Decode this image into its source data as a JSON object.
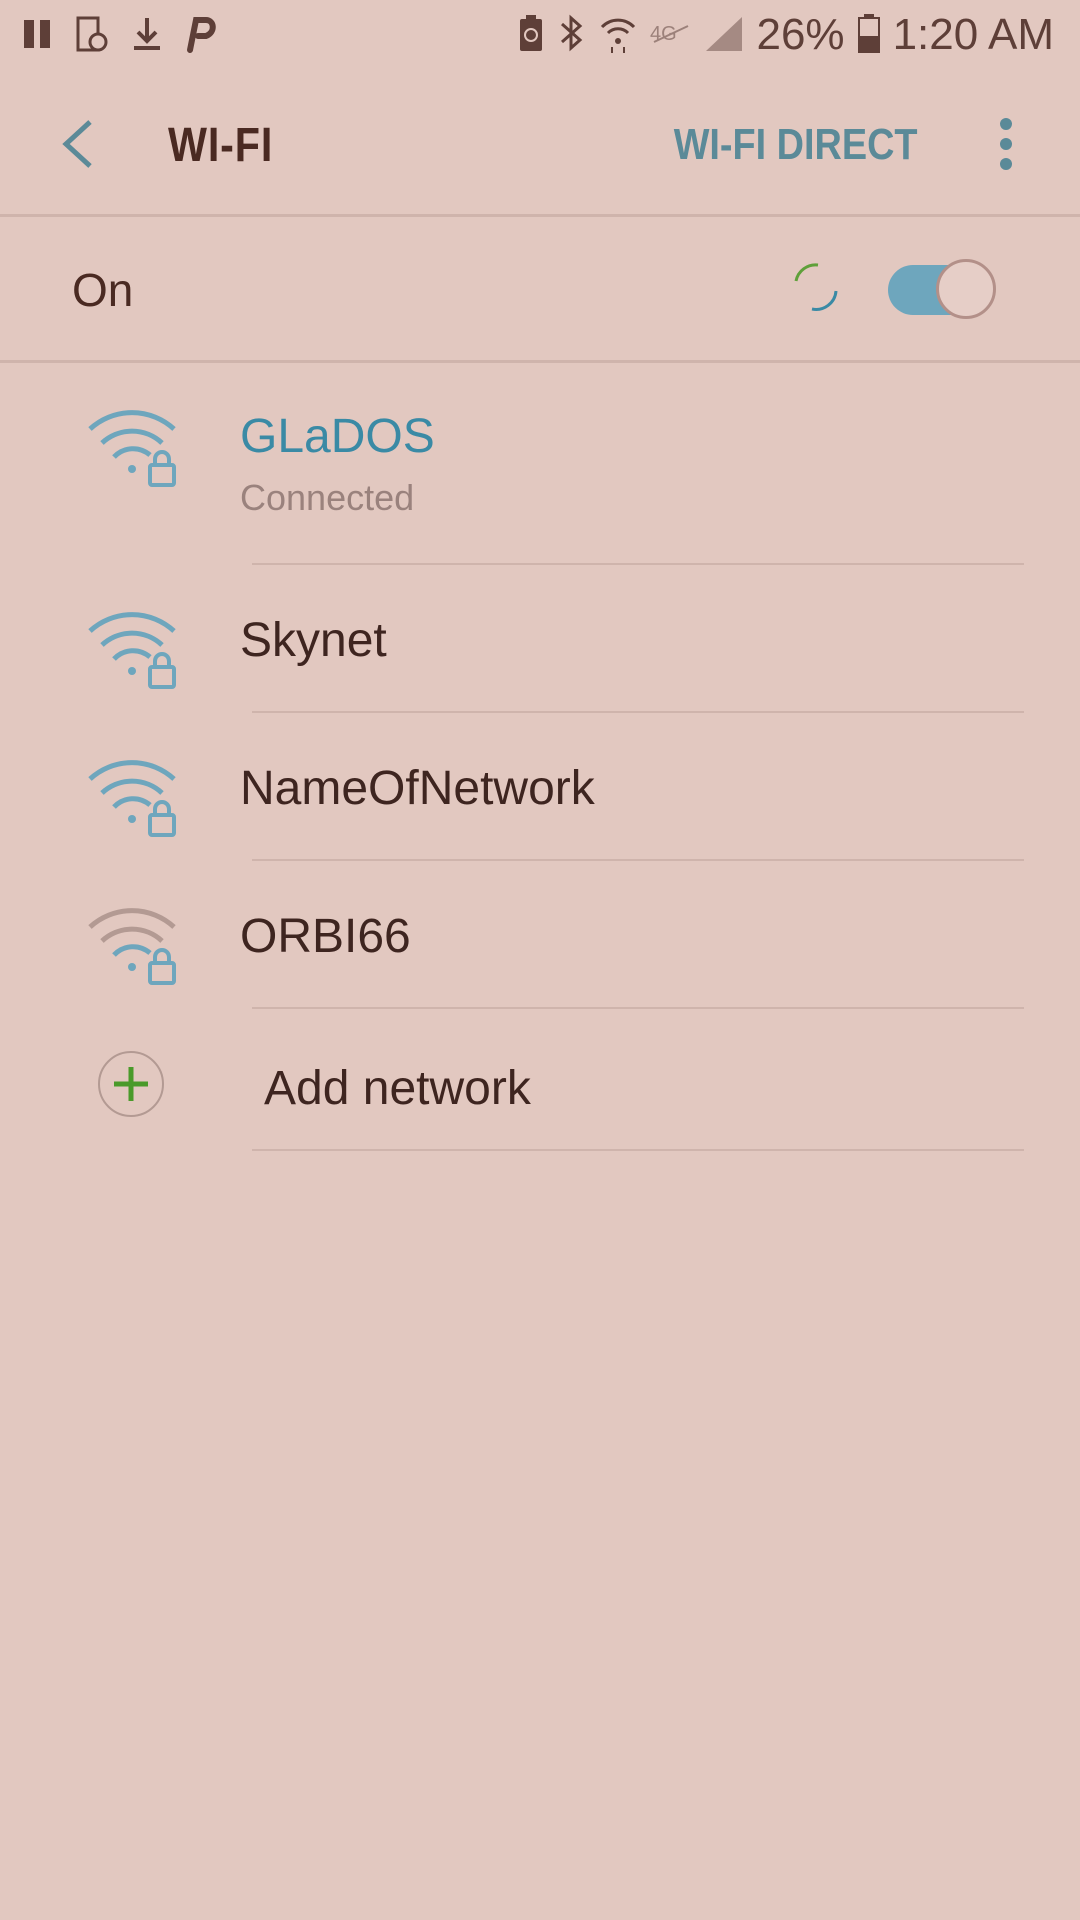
{
  "status_bar": {
    "left_icons": [
      "pause-icon",
      "screen-rotate-icon",
      "download-icon",
      "p-app-icon"
    ],
    "right_icons": [
      "battery-saver-icon",
      "bluetooth-icon",
      "wifi-signal-icon",
      "lte-icon",
      "cell-signal-icon"
    ],
    "battery_percent": "26%",
    "time": "1:20 AM"
  },
  "app_bar": {
    "title": "WI-FI",
    "wifi_direct_label": "WI-FI DIRECT"
  },
  "wifi_toggle": {
    "label": "On",
    "enabled": true
  },
  "networks": [
    {
      "name": "GLaDOS",
      "status": "Connected",
      "secured": true,
      "signal": "strong",
      "connected": true
    },
    {
      "name": "Skynet",
      "secured": true,
      "signal": "strong"
    },
    {
      "name": "NameOfNetwork",
      "secured": true,
      "signal": "strong"
    },
    {
      "name": "ORBI66",
      "secured": true,
      "signal": "strong",
      "dimmed": true
    }
  ],
  "add_network": {
    "label": "Add network"
  },
  "colors": {
    "background": "#e2c8c0",
    "accent": "#3a8aa5",
    "toggle_on": "#6ea6bd",
    "text": "#3e2520",
    "add_plus": "#4a9a2a"
  }
}
